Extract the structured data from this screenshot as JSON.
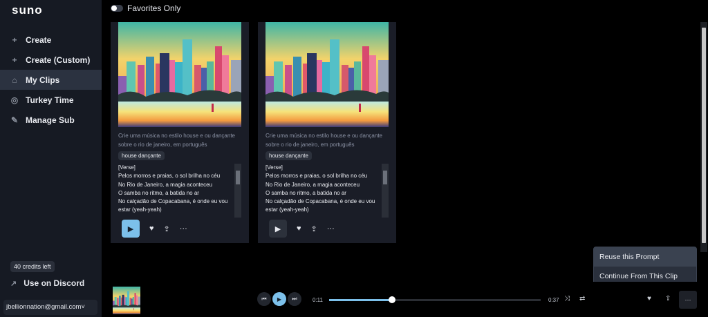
{
  "app": {
    "logo": "suno"
  },
  "sidebar": {
    "items": [
      {
        "label": "Create",
        "icon": "plus-icon",
        "glyph": "+"
      },
      {
        "label": "Create (Custom)",
        "icon": "plus-icon",
        "glyph": "+"
      },
      {
        "label": "My Clips",
        "icon": "home-icon",
        "glyph": "⌂"
      },
      {
        "label": "Turkey Time",
        "icon": "globe-icon",
        "glyph": "◎"
      },
      {
        "label": "Manage Sub",
        "icon": "edit-icon",
        "glyph": "✎"
      }
    ],
    "credits": "40 credits left",
    "discord": "Use on Discord",
    "email": "jbellionnation@gmail.com"
  },
  "filter": {
    "favorites_label": "Favorites Only",
    "favorites_on": false
  },
  "clips": [
    {
      "description": "Crie uma música no estilo house e ou dançante sobre o rio de janeiro, em português",
      "tag": "house dançante",
      "lyrics": [
        "[Verse]",
        "Pelos morros e praias, o sol brilha no céu",
        "No Rio de Janeiro, a magia aconteceu",
        "O samba no ritmo, a batida no ar",
        "No calçadão de Copacabana, é onde eu vou",
        "estar (yeah-yeah)"
      ],
      "playing": true
    },
    {
      "description": "Crie uma música no estilo house e ou dançante sobre o rio de janeiro, em português",
      "tag": "house dançante",
      "lyrics": [
        "[Verse]",
        "Pelos morros e praias, o sol brilha no céu",
        "No Rio de Janeiro, a magia aconteceu",
        "O samba no ritmo, a batida no ar",
        "No calçadão de Copacabana, é onde eu vou",
        "estar (yeah-yeah)"
      ],
      "playing": false
    }
  ],
  "context_menu": {
    "items": [
      "Reuse this Prompt",
      "Continue From This Clip"
    ]
  },
  "player": {
    "current": "0:11",
    "duration": "0:37",
    "progress": 0.297
  },
  "colors": {
    "accent": "#7cc0ea",
    "sidebar": "#161a23",
    "card": "#1a1d27"
  }
}
